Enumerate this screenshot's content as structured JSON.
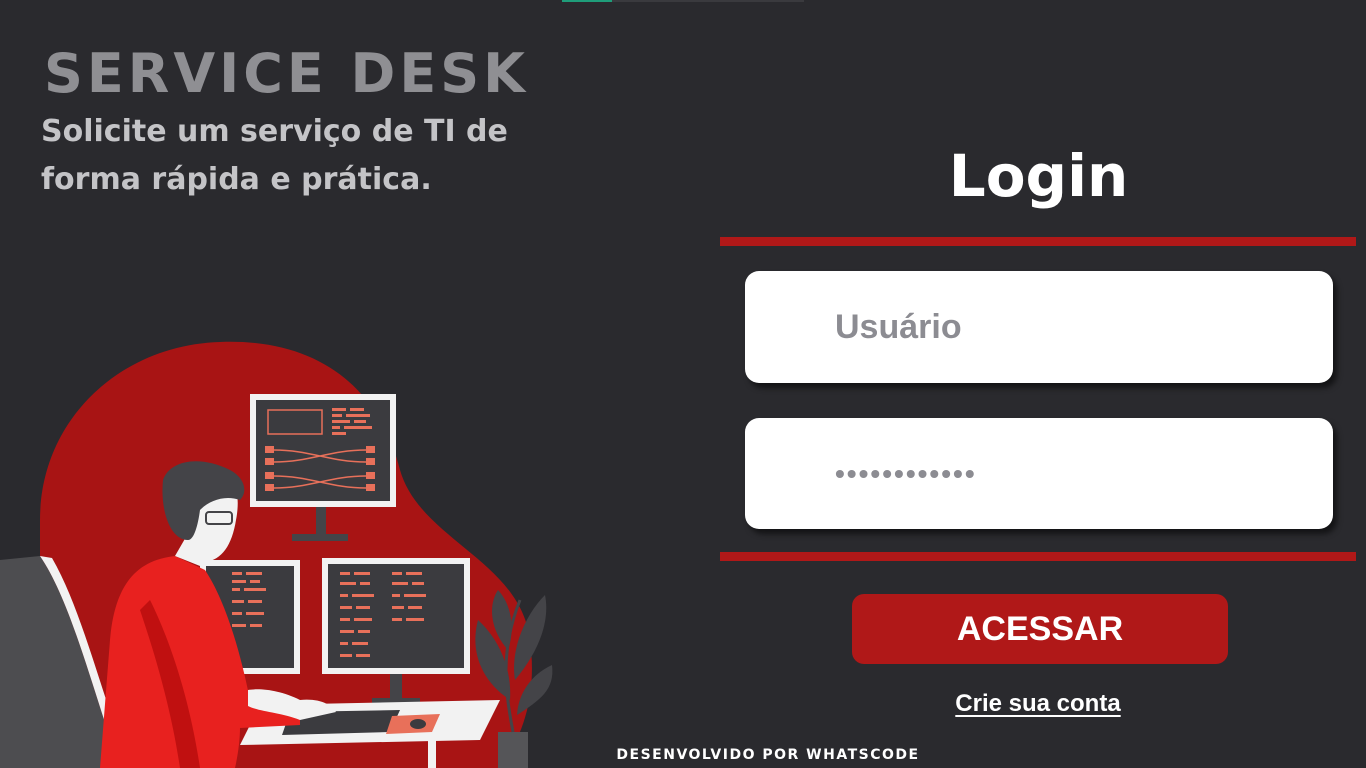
{
  "brand": {
    "title": "SERVICE DESK",
    "subtitle": "Solicite um serviço de TI  de forma rápida e prática."
  },
  "login": {
    "title": "Login",
    "username_placeholder": "Usuário",
    "password_value": "••••••••••••",
    "submit_label": "ACESSAR",
    "signup_link": "Crie sua conta"
  },
  "footer": {
    "credits": "DESENVOLVIDO POR WHATSCODE"
  },
  "colors": {
    "background": "#2a2a2e",
    "accent": "#b01818",
    "title_gray": "#8f8f93",
    "subtitle_gray": "#c4c4c7",
    "field_text": "#8c8c92"
  },
  "illustration": {
    "subject": "person working at computer desk with monitors"
  }
}
